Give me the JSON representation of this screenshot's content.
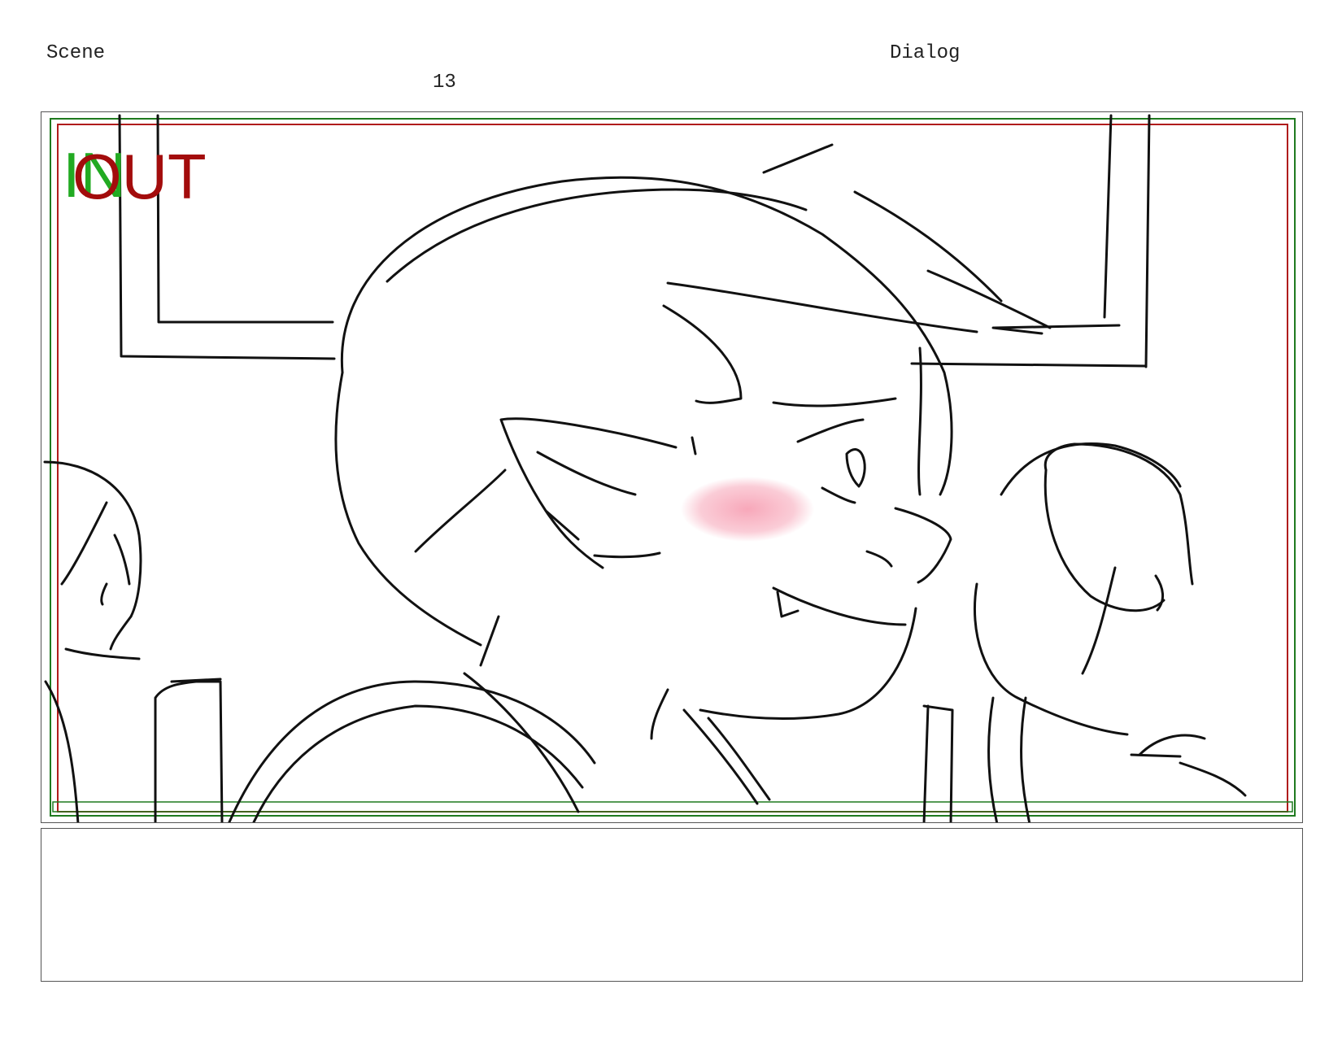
{
  "header": {
    "scene_label": "Scene",
    "scene_number": "13",
    "dialog_label": "Dialog"
  },
  "panel": {
    "in_mark": "IN",
    "out_mark": "OUT",
    "in_color": "#22aa22",
    "out_color": "#a30c0c",
    "safe_frame_color": "#1f7a1f",
    "action_frame_color": "#b01c1c",
    "blush_color": "#f7a3b6"
  },
  "dialog": {
    "text": ""
  }
}
